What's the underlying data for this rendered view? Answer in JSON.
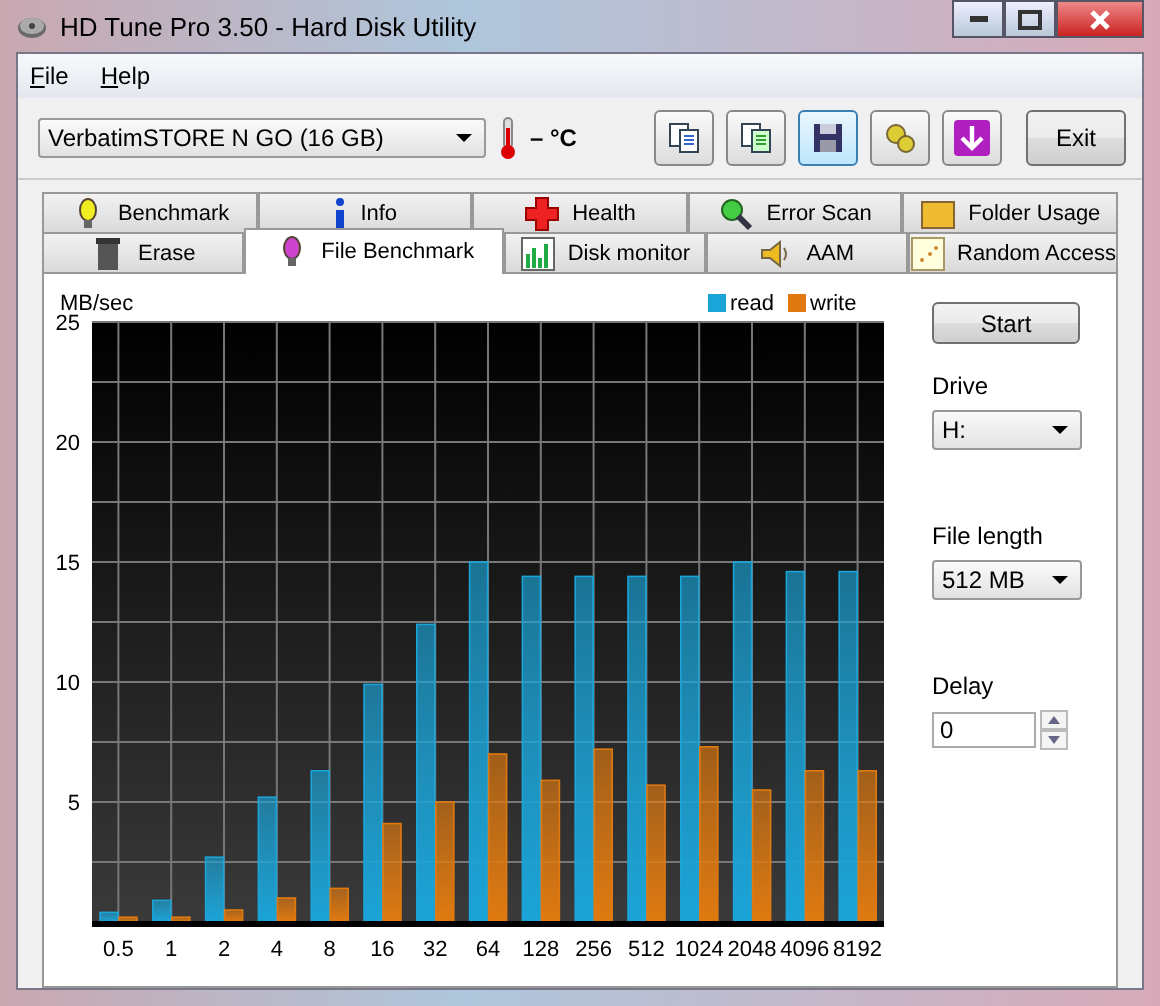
{
  "window": {
    "title": "HD Tune Pro 3.50 - Hard Disk Utility"
  },
  "menu": [
    {
      "label": "File"
    },
    {
      "label": "Help"
    }
  ],
  "toolbar": {
    "drive": "VerbatimSTORE N GO (16 GB)",
    "temperature": "– °C",
    "exit": "Exit"
  },
  "tab_rows": [
    [
      {
        "label": "Benchmark",
        "selected": false
      },
      {
        "label": "Info",
        "selected": false
      },
      {
        "label": "Health",
        "selected": false
      },
      {
        "label": "Error Scan",
        "selected": false
      },
      {
        "label": "Folder Usage",
        "selected": false
      }
    ],
    [
      {
        "label": "Erase",
        "selected": false
      },
      {
        "label": "File Benchmark",
        "selected": true
      },
      {
        "label": "Disk monitor",
        "selected": false
      },
      {
        "label": "AAM",
        "selected": false
      },
      {
        "label": "Random Access",
        "selected": false
      }
    ]
  ],
  "chart_data": {
    "type": "bar",
    "ylabel": "MB/sec",
    "categories": [
      "0.5",
      "1",
      "2",
      "4",
      "8",
      "16",
      "32",
      "64",
      "128",
      "256",
      "512",
      "1024",
      "2048",
      "4096",
      "8192"
    ],
    "series": [
      {
        "name": "read",
        "color": "#1ba4d8",
        "values": [
          0.4,
          0.9,
          2.7,
          5.2,
          6.3,
          9.9,
          12.4,
          15.0,
          14.4,
          14.4,
          14.4,
          14.4,
          15.0,
          14.6,
          14.6
        ]
      },
      {
        "name": "write",
        "color": "#e07a10",
        "values": [
          0.2,
          0.2,
          0.5,
          1.0,
          1.4,
          4.1,
          5.0,
          7.0,
          5.9,
          7.2,
          5.7,
          7.3,
          5.5,
          6.3,
          6.3
        ]
      }
    ],
    "ylim": [
      0,
      25
    ],
    "yticks": [
      5,
      10,
      15,
      20,
      25
    ],
    "grid": true,
    "legend": true
  },
  "side": {
    "start": "Start",
    "drive_label": "Drive",
    "drive": "H:",
    "length_label": "File length",
    "length": "512 MB",
    "delay_label": "Delay",
    "delay": "0"
  }
}
